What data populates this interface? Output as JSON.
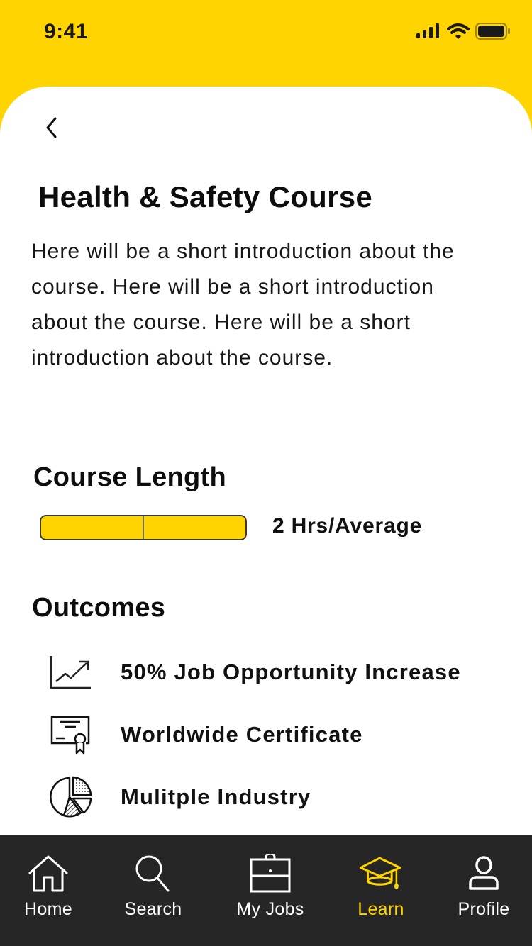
{
  "status_bar": {
    "time": "9:41",
    "icons": [
      "signal-icon",
      "wifi-icon",
      "battery-icon"
    ]
  },
  "header": {
    "back_icon": "chevron-left-icon"
  },
  "course": {
    "title": "Health & Safety Course",
    "intro": "Here will be a short introduction about the course. Here will be a short introduction about the course. Here will be a short introduction about the course.",
    "length": {
      "heading": "Course Length",
      "value_label": "2 Hrs/Average",
      "bar_fill_fraction": 1.0,
      "bar_segments": 2
    },
    "outcomes": {
      "heading": "Outcomes",
      "items": [
        {
          "icon": "trending-up-chart-icon",
          "label": "50% Job Opportunity Increase"
        },
        {
          "icon": "certificate-icon",
          "label": "Worldwide Certificate"
        },
        {
          "icon": "pie-chart-icon",
          "label": "Mulitple Industry"
        }
      ]
    }
  },
  "tabbar": {
    "active": "Learn",
    "items": [
      {
        "icon": "home-icon",
        "label": "Home"
      },
      {
        "icon": "search-icon",
        "label": "Search"
      },
      {
        "icon": "briefcase-icon",
        "label": "My Jobs"
      },
      {
        "icon": "graduation-cap-icon",
        "label": "Learn"
      },
      {
        "icon": "profile-icon",
        "label": "Profile"
      }
    ]
  },
  "colors": {
    "brand_yellow": "#FFD400",
    "tabbar_bg": "#262626",
    "text_dark": "#111111",
    "tab_inactive": "#FFFFFF"
  }
}
